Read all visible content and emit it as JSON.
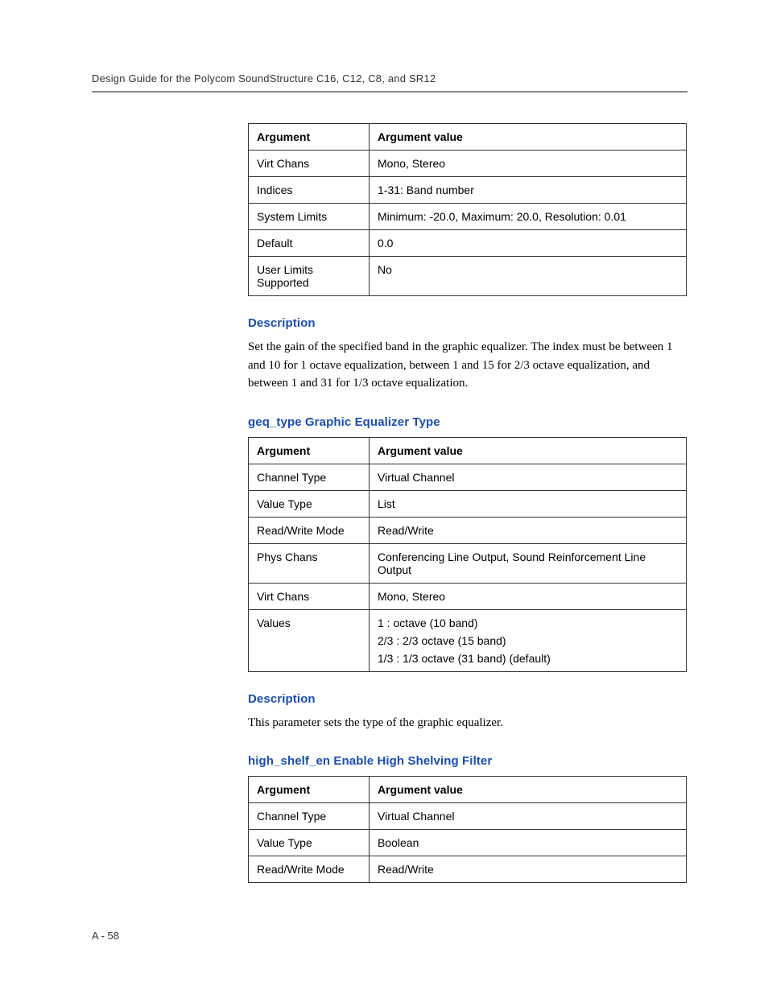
{
  "header": {
    "title": "Design Guide for the Polycom SoundStructure C16, C12, C8, and SR12"
  },
  "table1": {
    "headers": {
      "col1": "Argument",
      "col2": "Argument value"
    },
    "rows": [
      {
        "argument": "Virt Chans",
        "value": "Mono, Stereo"
      },
      {
        "argument": "Indices",
        "value": "1-31: Band number"
      },
      {
        "argument": "System Limits",
        "value": "Minimum: -20.0, Maximum: 20.0, Resolution: 0.01"
      },
      {
        "argument": "Default",
        "value": "0.0"
      },
      {
        "argument": "User Limits Supported",
        "value": "No"
      }
    ]
  },
  "section1": {
    "heading": "Description",
    "text": "Set the gain of the specified band in the graphic equalizer. The index must be between 1 and 10 for 1 octave equalization, between 1 and 15 for 2/3 octave equalization, and between 1 and 31 for 1/3 octave equalization."
  },
  "section2": {
    "heading": "geq_type Graphic Equalizer Type"
  },
  "table2": {
    "headers": {
      "col1": "Argument",
      "col2": "Argument value"
    },
    "rows": [
      {
        "argument": "Channel Type",
        "value": "Virtual Channel"
      },
      {
        "argument": "Value Type",
        "value": "List"
      },
      {
        "argument": "Read/Write Mode",
        "value": "Read/Write"
      },
      {
        "argument": "Phys Chans",
        "value": "Conferencing Line Output, Sound Reinforcement Line Output"
      },
      {
        "argument": "Virt Chans",
        "value": "Mono, Stereo"
      }
    ],
    "valuesRow": {
      "argument": "Values",
      "lines": [
        "1 : octave (10 band)",
        "2/3 : 2/3 octave (15 band)",
        "1/3 : 1/3 octave (31 band) (default)"
      ]
    }
  },
  "section3": {
    "heading": "Description",
    "text": "This parameter sets the type of the graphic equalizer."
  },
  "section4": {
    "heading": "high_shelf_en Enable High Shelving Filter"
  },
  "table3": {
    "headers": {
      "col1": "Argument",
      "col2": "Argument value"
    },
    "rows": [
      {
        "argument": "Channel Type",
        "value": "Virtual Channel"
      },
      {
        "argument": "Value Type",
        "value": "Boolean"
      },
      {
        "argument": "Read/Write Mode",
        "value": "Read/Write"
      }
    ]
  },
  "footer": {
    "pageNumber": "A - 58"
  }
}
